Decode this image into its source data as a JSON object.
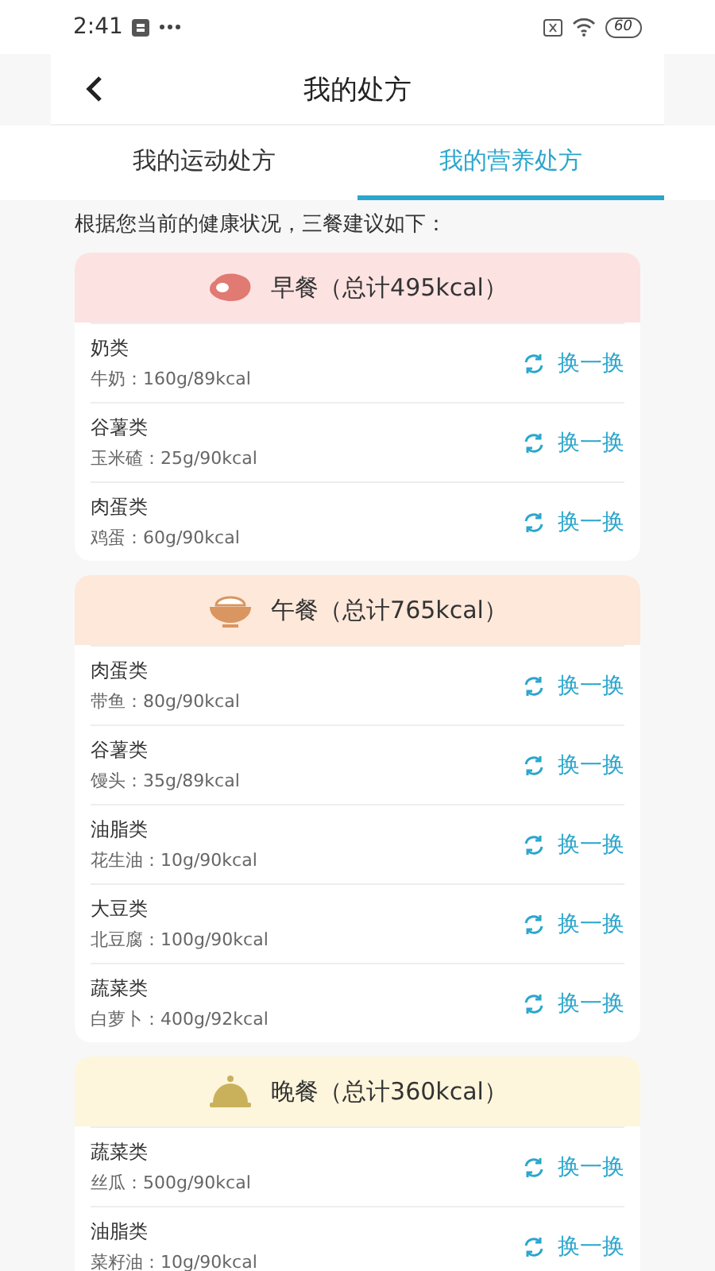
{
  "status_bar": {
    "time": "2:41",
    "battery": "60"
  },
  "header": {
    "title": "我的处方"
  },
  "tabs": [
    {
      "label": "我的运动处方",
      "selected": false
    },
    {
      "label": "我的营养处方",
      "selected": true
    }
  ],
  "intro": "根据您当前的健康状况，三餐建议如下：",
  "meals": [
    {
      "kind": "breakfast",
      "title": "早餐（总计495kcal）",
      "items": [
        {
          "category": "奶类",
          "detail": "牛奶：160g/89kcal",
          "action": "换一换"
        },
        {
          "category": "谷薯类",
          "detail": "玉米碴：25g/90kcal",
          "action": "换一换"
        },
        {
          "category": "肉蛋类",
          "detail": "鸡蛋：60g/90kcal",
          "action": "换一换"
        }
      ]
    },
    {
      "kind": "lunch",
      "title": "午餐（总计765kcal）",
      "items": [
        {
          "category": "肉蛋类",
          "detail": "带鱼：80g/90kcal",
          "action": "换一换"
        },
        {
          "category": "谷薯类",
          "detail": "馒头：35g/89kcal",
          "action": "换一换"
        },
        {
          "category": "油脂类",
          "detail": "花生油：10g/90kcal",
          "action": "换一换"
        },
        {
          "category": "大豆类",
          "detail": "北豆腐：100g/90kcal",
          "action": "换一换"
        },
        {
          "category": "蔬菜类",
          "detail": "白萝卜：400g/92kcal",
          "action": "换一换"
        }
      ]
    },
    {
      "kind": "dinner",
      "title": "晚餐（总计360kcal）",
      "items": [
        {
          "category": "蔬菜类",
          "detail": "丝瓜：500g/90kcal",
          "action": "换一换"
        },
        {
          "category": "油脂类",
          "detail": "菜籽油：10g/90kcal",
          "action": "换一换"
        }
      ]
    }
  ]
}
